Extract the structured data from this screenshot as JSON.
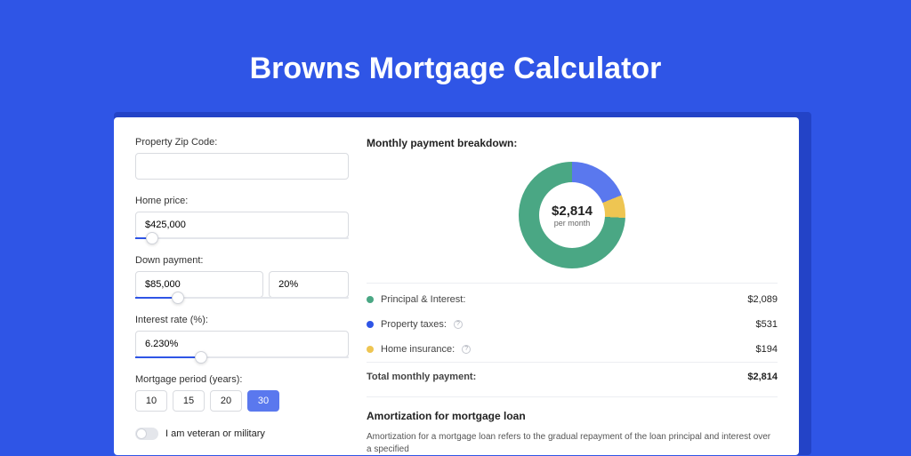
{
  "title": "Browns Mortgage Calculator",
  "form": {
    "zip_label": "Property Zip Code:",
    "zip_value": "",
    "home_price_label": "Home price:",
    "home_price_value": "$425,000",
    "home_price_slider_pct": 8,
    "down_payment_label": "Down payment:",
    "down_payment_value": "$85,000",
    "down_payment_pct": "20%",
    "down_payment_slider_pct": 20,
    "interest_label": "Interest rate (%):",
    "interest_value": "6.230%",
    "interest_slider_pct": 31,
    "period_label": "Mortgage period (years):",
    "periods": [
      "10",
      "15",
      "20",
      "30"
    ],
    "period_active_index": 3,
    "veteran_label": "I am veteran or military"
  },
  "breakdown": {
    "title": "Monthly payment breakdown:",
    "center_amount": "$2,814",
    "center_sub": "per month",
    "rows": [
      {
        "label": "Principal & Interest:",
        "value": "$2,089",
        "color": "green",
        "help": false
      },
      {
        "label": "Property taxes:",
        "value": "$531",
        "color": "blue",
        "help": true
      },
      {
        "label": "Home insurance:",
        "value": "$194",
        "color": "yellow",
        "help": true
      }
    ],
    "total_label": "Total monthly payment:",
    "total_value": "$2,814"
  },
  "amortization": {
    "title": "Amortization for mortgage loan",
    "text": "Amortization for a mortgage loan refers to the gradual repayment of the loan principal and interest over a specified"
  },
  "chart_data": {
    "type": "pie",
    "title": "Monthly payment breakdown",
    "series": [
      {
        "name": "Principal & Interest",
        "value": 2089,
        "color": "#4aa784"
      },
      {
        "name": "Property taxes",
        "value": 531,
        "color": "#2f55e6"
      },
      {
        "name": "Home insurance",
        "value": 194,
        "color": "#eec552"
      }
    ],
    "center_label": "$2,814 per month",
    "total": 2814
  }
}
